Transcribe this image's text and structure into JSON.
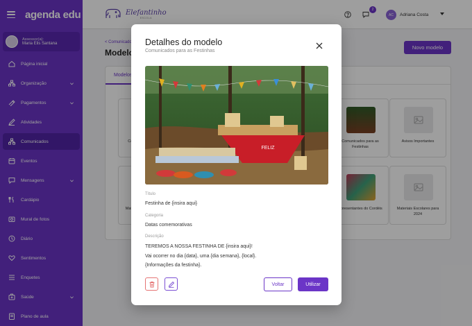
{
  "sidebar": {
    "brand": "agenda edu",
    "assessor": {
      "role": "Assessor(a):",
      "name": "Maria Elis Santana"
    },
    "items": [
      {
        "label": "Página inicial",
        "icon": "home-icon"
      },
      {
        "label": "Organização",
        "icon": "org-icon",
        "has_submenu": true
      },
      {
        "label": "Pagamentos",
        "icon": "payments-icon",
        "has_submenu": true
      },
      {
        "label": "Atividades",
        "icon": "activities-icon"
      },
      {
        "label": "Comunicados",
        "icon": "announcements-icon",
        "active": true
      },
      {
        "label": "Eventos",
        "icon": "calendar-icon"
      },
      {
        "label": "Mensagens",
        "icon": "messages-icon",
        "has_submenu": true
      },
      {
        "label": "Cardápio",
        "icon": "menu-icon"
      },
      {
        "label": "Mural de fotos",
        "icon": "photos-icon"
      },
      {
        "label": "Diário",
        "icon": "diary-icon"
      },
      {
        "label": "Sentimentos",
        "icon": "feelings-icon"
      },
      {
        "label": "Enquetes",
        "icon": "polls-icon"
      },
      {
        "label": "Saúde",
        "icon": "health-icon",
        "has_submenu": true
      },
      {
        "label": "Plano de aula",
        "icon": "lesson-plan-icon"
      }
    ]
  },
  "header": {
    "school_logo": {
      "name": "Elefantinho",
      "tagline": "ESCOLA"
    },
    "notifications_count": "2",
    "user": {
      "initials": "AC",
      "name": "Adriana Costa"
    }
  },
  "page": {
    "breadcrumb": "< Comunicados",
    "title": "Modelos",
    "new_button": "Novo modelo",
    "tab": "Modelos",
    "cards": [
      {
        "title": "Comunicados para as Festinhas",
        "has_image": true
      },
      {
        "title": "Avisos Importantes",
        "has_image": false
      },
      {
        "title": "Apresentantes do Cordéis",
        "has_image": true
      },
      {
        "title": "Materiais Escolares para 2024",
        "has_image": false
      }
    ]
  },
  "modal": {
    "title": "Detalhes do modelo",
    "subtitle": "Comunicados para as Festinhas",
    "fields": {
      "titulo_label": "Título",
      "titulo_value": "Festinha de {insira aqui}",
      "categoria_label": "Categoria",
      "categoria_value": "Datas comemorativas",
      "descricao_label": "Descrição",
      "descricao_lines": [
        "TEREMOS A NOSSA FESTINHA DE {insira aqui}!",
        "Vai ocorrer no dia {data}, uma {dia semana}, {local}.",
        "{Informações da festinha}."
      ]
    },
    "image_banner_text": "FELIZ",
    "actions": {
      "back": "Voltar",
      "use": "Utilizar"
    }
  },
  "colors": {
    "primary": "#6b35c7",
    "sidebar_active": "#5124a6",
    "delete": "#e57373"
  }
}
